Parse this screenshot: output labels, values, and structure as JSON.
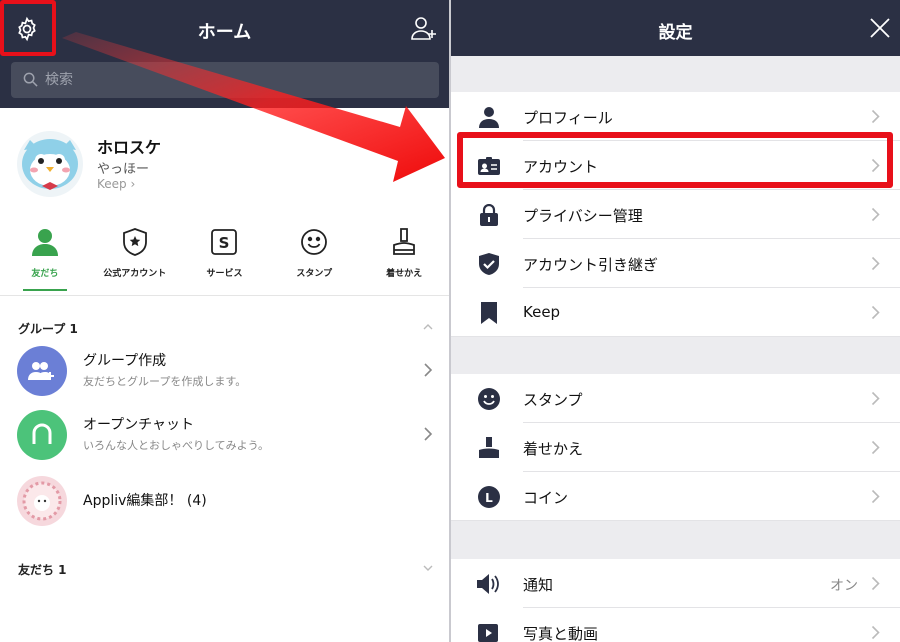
{
  "left": {
    "header": {
      "title": "ホーム"
    },
    "search": {
      "placeholder": "検索"
    },
    "profile": {
      "name": "ホロスケ",
      "status": "やっほー",
      "keep": "Keep"
    },
    "tabs": [
      {
        "label": "友だち",
        "icon": "person-icon",
        "active": true
      },
      {
        "label": "公式アカウント",
        "icon": "official-badge-icon"
      },
      {
        "label": "サービス",
        "icon": "service-s-icon"
      },
      {
        "label": "スタンプ",
        "icon": "smiley-icon"
      },
      {
        "label": "着せかえ",
        "icon": "brush-icon"
      }
    ],
    "groups_header": "グループ 1",
    "groups": [
      {
        "name": "グループ作成",
        "sub": "友だちとグループを作成します。"
      },
      {
        "name": "オープンチャット",
        "sub": "いろんな人とおしゃべりしてみよう。"
      },
      {
        "name": "Appliv編集部！ (4)",
        "sub": ""
      }
    ],
    "friends_header": "友だち 1"
  },
  "right": {
    "header": {
      "title": "設定"
    },
    "items": [
      {
        "label": "プロフィール",
        "icon": "person-icon"
      },
      {
        "label": "アカウント",
        "icon": "id-card-icon"
      },
      {
        "label": "プライバシー管理",
        "icon": "lock-icon"
      },
      {
        "label": "アカウント引き継ぎ",
        "icon": "shield-check-icon"
      },
      {
        "label": "Keep",
        "icon": "bookmark-icon"
      },
      {
        "label": "スタンプ",
        "icon": "smiley-icon"
      },
      {
        "label": "着せかえ",
        "icon": "brush-icon"
      },
      {
        "label": "コイン",
        "icon": "coin-icon"
      },
      {
        "label": "通知",
        "icon": "speaker-icon",
        "value": "オン"
      },
      {
        "label": "写真と動画",
        "icon": "photo-video-icon"
      }
    ]
  },
  "colors": {
    "header": "#2b3044",
    "highlight": "#e8101a",
    "accent": "#39a34e"
  }
}
